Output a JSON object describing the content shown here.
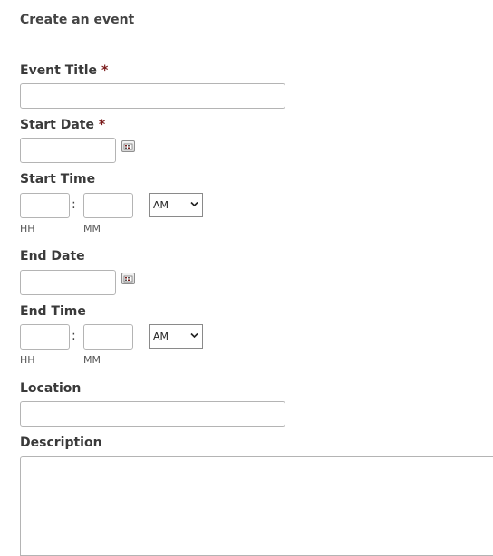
{
  "form": {
    "heading": "Create an event",
    "required_marker": "*",
    "event_title": {
      "label": "Event Title",
      "value": ""
    },
    "start_date": {
      "label": "Start Date",
      "value": ""
    },
    "start_time": {
      "label": "Start Time",
      "hour": "",
      "minute": "",
      "separator": ":",
      "hour_hint": "HH",
      "minute_hint": "MM",
      "ampm": "AM"
    },
    "end_date": {
      "label": "End Date",
      "value": ""
    },
    "end_time": {
      "label": "End Time",
      "hour": "",
      "minute": "",
      "separator": ":",
      "hour_hint": "HH",
      "minute_hint": "MM",
      "ampm": "AM"
    },
    "location": {
      "label": "Location",
      "value": ""
    },
    "description": {
      "label": "Description",
      "value": ""
    }
  },
  "icons": {
    "calendar": "calendar-icon",
    "dropdown": "chevron-down-icon"
  },
  "colors": {
    "required": "#7a1a1a",
    "border": "#b4b4b4",
    "text": "#3a3a3a"
  }
}
